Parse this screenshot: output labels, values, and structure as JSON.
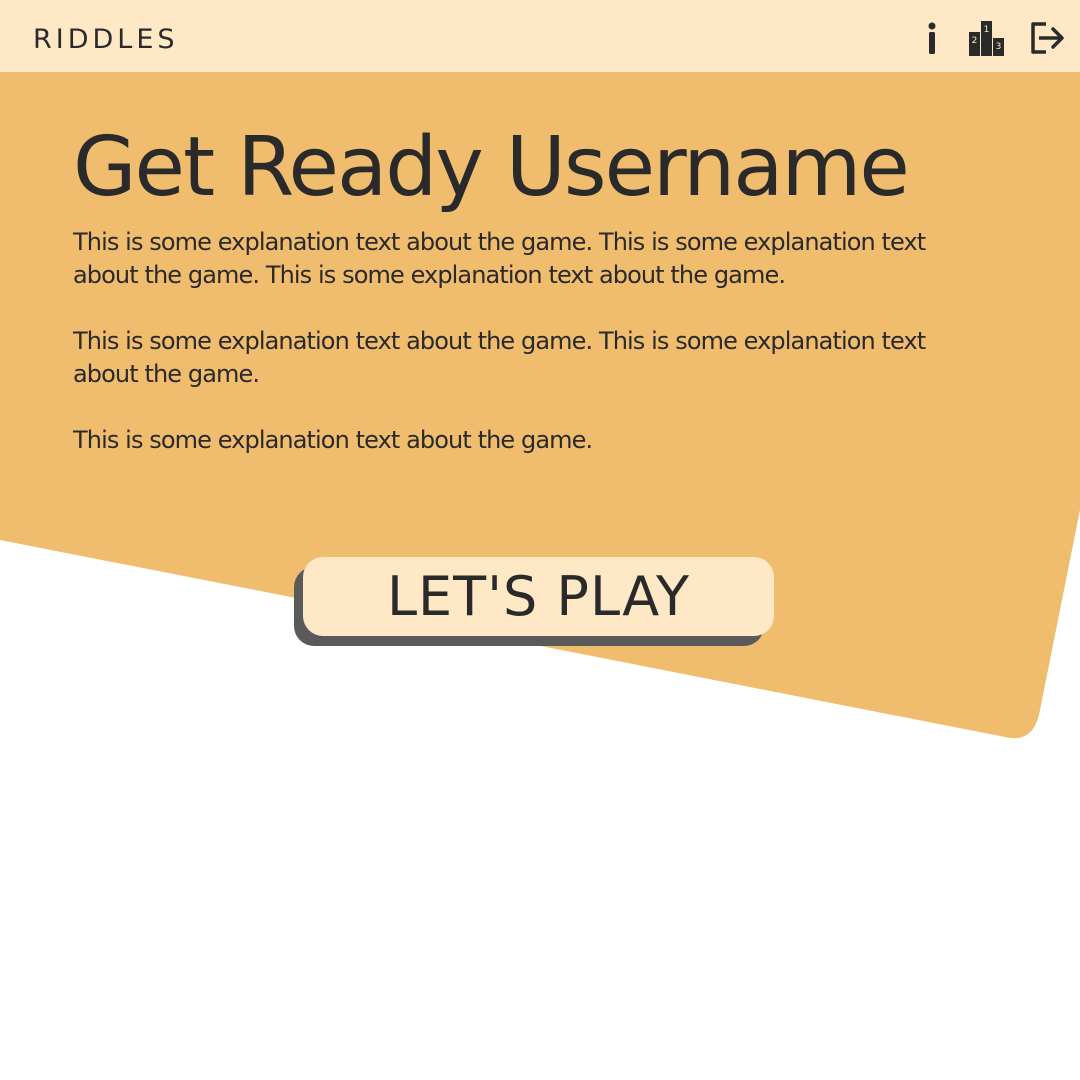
{
  "header": {
    "app_title": "RIDDLES",
    "icons": {
      "info": "info-icon",
      "leaderboard": "podium-icon",
      "logout": "logout-icon"
    },
    "podium_numbers": [
      "2",
      "1",
      "3"
    ]
  },
  "main": {
    "heading": "Get Ready Username",
    "paragraph_1_line_1": "This is some explanation text about the game. This is some explanation text",
    "paragraph_1_line_2": "about the game. This is some explanation text about the game.",
    "paragraph_2_line_1": "This is some explanation text about the game. This is some explanation text",
    "paragraph_2_line_2": "about the game.",
    "paragraph_3": "This is some explanation text about the game.",
    "play_button": "LET'S PLAY"
  },
  "colors": {
    "header_bg": "#fee8c5",
    "accent_panel": "#f0bd6f",
    "page_bg": "#ffffff",
    "text": "#2a2a2a",
    "button_shadow": "#5a5a5a"
  }
}
